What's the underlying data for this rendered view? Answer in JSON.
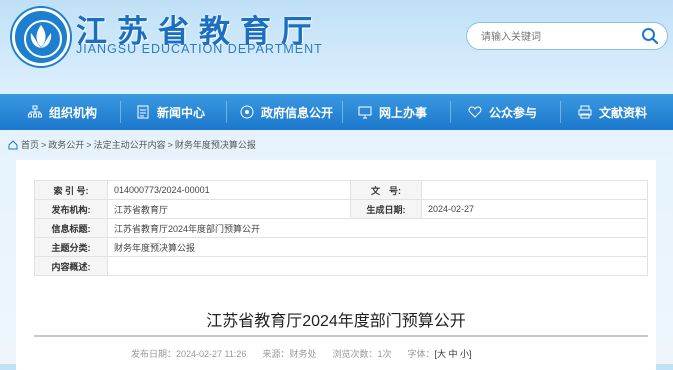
{
  "header": {
    "title": "江苏省教育厅",
    "subtitle": "JIANGSU EDUCATION DEPARTMENT",
    "search_placeholder": "请输入关键词",
    "brand_color": "#1c78cc"
  },
  "nav": {
    "items": [
      {
        "label": "组织机构",
        "icon": "org-icon"
      },
      {
        "label": "新闻中心",
        "icon": "document-icon"
      },
      {
        "label": "政府信息公开",
        "icon": "target-icon"
      },
      {
        "label": "网上办事",
        "icon": "monitor-icon"
      },
      {
        "label": "公众参与",
        "icon": "heart-icon"
      },
      {
        "label": "文献资料",
        "icon": "printer-icon"
      }
    ]
  },
  "breadcrumb": [
    "首页",
    "政务公开",
    "法定主动公开内容",
    "财务年度预决算公报"
  ],
  "breadcrumb_sep": ">",
  "meta": {
    "rows": [
      {
        "k1": "索 引 号:",
        "v1": "014000773/2024-00001",
        "k2": "文　号:",
        "v2": ""
      },
      {
        "k1": "发布机构:",
        "v1": "江苏省教育厅",
        "k2": "生成日期:",
        "v2": "2024-02-27"
      },
      {
        "k1": "信息标题:",
        "v1": "江苏省教育厅2024年度部门预算公开"
      },
      {
        "k1": "主题分类:",
        "v1": "财务年度预决算公报"
      },
      {
        "k1": "内容概述:",
        "v1": ""
      }
    ]
  },
  "article": {
    "title": "江苏省教育厅2024年度部门预算公开",
    "date_label": "发布日期：",
    "date": "2024-02-27 11:26",
    "source_label": "来源：",
    "source": "财务处",
    "views_label": "浏览次数：",
    "views": "1次",
    "fontsize_label": "字体：",
    "fontsize_options": "[大 中 小]"
  }
}
